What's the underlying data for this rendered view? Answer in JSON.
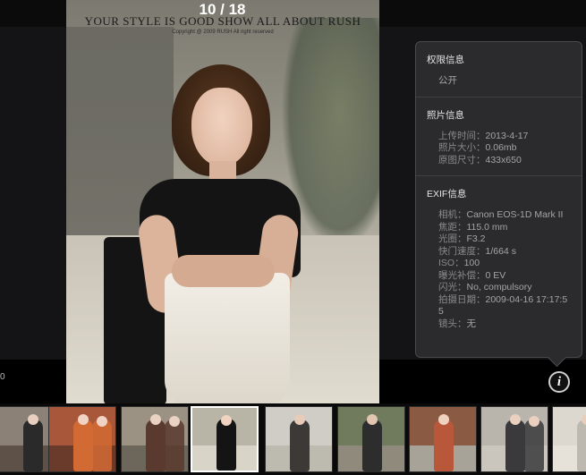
{
  "viewer": {
    "counter": "10 / 18",
    "photo_banner": "YOUR STYLE IS GOOD SHOW  ALL ABOUT RUSH",
    "photo_copyright": "Copyright @ 2009 RUSH All right reserved",
    "left_edge_label": "0"
  },
  "info_panel": {
    "privacy": {
      "title": "权限信息",
      "value": "公开"
    },
    "photo_info": {
      "title": "照片信息",
      "rows": [
        {
          "k": "上传时间：",
          "v": "2013-4-17"
        },
        {
          "k": "照片大小：",
          "v": "0.06mb"
        },
        {
          "k": "原图尺寸：",
          "v": "433x650"
        }
      ]
    },
    "exif": {
      "title": "EXIF信息",
      "rows": [
        {
          "k": "相机：",
          "v": "Canon EOS-1D Mark II"
        },
        {
          "k": "焦距：",
          "v": "115.0 mm"
        },
        {
          "k": "光圈：",
          "v": "F3.2"
        },
        {
          "k": "快门速度：",
          "v": "1/664 s"
        },
        {
          "k": "ISO：",
          "v": "100"
        },
        {
          "k": "曝光补偿：",
          "v": "0 EV"
        },
        {
          "k": "闪光：",
          "v": "No, compulsory"
        },
        {
          "k": "拍摄日期：",
          "v": "2009-04-16 17:17:55"
        },
        {
          "k": "镜头：",
          "v": "无"
        }
      ]
    },
    "info_button_glyph": "i"
  },
  "thumbnails": {
    "active_index": 3,
    "items": [
      {
        "name": "thumb-1"
      },
      {
        "name": "thumb-2"
      },
      {
        "name": "thumb-3"
      },
      {
        "name": "thumb-4"
      },
      {
        "name": "thumb-5"
      },
      {
        "name": "thumb-6"
      },
      {
        "name": "thumb-7"
      },
      {
        "name": "thumb-8"
      },
      {
        "name": "thumb-9"
      }
    ]
  },
  "colors": {
    "panel_bg": "#2b2b2d",
    "panel_border": "#4a4a4d",
    "active_thumb_border": "#ffffff"
  }
}
